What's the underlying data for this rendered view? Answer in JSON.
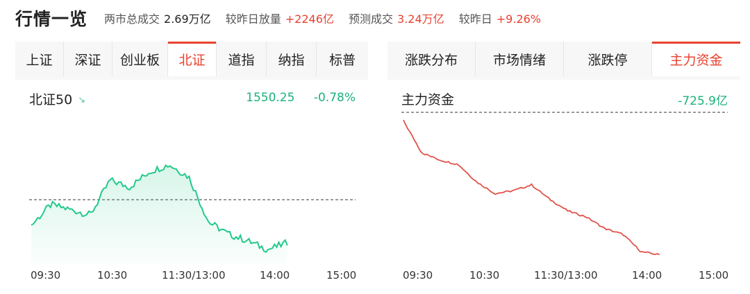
{
  "header": {
    "title": "行情一览",
    "stats": [
      {
        "label": "两市总成交",
        "value": "2.69万亿",
        "tone": "neutral"
      },
      {
        "label": "较昨日放量",
        "value": "+2246亿",
        "tone": "up"
      },
      {
        "label": "预测成交",
        "value": "3.24万亿",
        "tone": "up"
      },
      {
        "label": "较昨日",
        "value": "+9.26%",
        "tone": "up"
      }
    ]
  },
  "left_panel": {
    "tabs": [
      "上证",
      "深证",
      "创业板",
      "北证",
      "道指",
      "纳指",
      "标普"
    ],
    "active_tab": "北证",
    "index_name": "北证50",
    "trend_icon": "down-right-arrow-icon",
    "price": "1550.25",
    "change_pct": "-0.78%",
    "x_labels": [
      "09:30",
      "10:30",
      "11:30/13:00",
      "14:00",
      "15:00"
    ]
  },
  "right_panel": {
    "tabs": [
      "涨跌分布",
      "市场情绪",
      "涨跌停",
      "主力资金"
    ],
    "active_tab": "主力资金",
    "series_name": "主力资金",
    "value": "-725.9亿",
    "x_labels": [
      "09:30",
      "10:30",
      "11:30/13:00",
      "14:00",
      "15:00"
    ]
  },
  "colors": {
    "up": "#e8412f",
    "down": "#1ab27a",
    "line_green": "#22c98a",
    "line_red": "#e0524a",
    "active_tab": "#e8412f"
  },
  "chart_data": [
    {
      "type": "area",
      "x": [
        "09:30",
        "09:45",
        "10:00",
        "10:15",
        "10:30",
        "10:45",
        "11:00",
        "11:15",
        "11:30/13:00",
        "13:15",
        "13:30",
        "13:45",
        "14:00",
        "14:05"
      ],
      "series": [
        {
          "name": "北证50",
          "values": [
            1550,
            1562,
            1559,
            1556,
            1576,
            1572,
            1581,
            1585,
            1578,
            1552,
            1545,
            1541,
            1536,
            1540
          ]
        }
      ],
      "baseline": 1562.4,
      "ylim": [
        1530,
        1590
      ],
      "xlabel": "",
      "ylabel": ""
    },
    {
      "type": "line",
      "x": [
        "09:30",
        "09:35",
        "09:45",
        "10:00",
        "10:15",
        "10:30",
        "10:45",
        "11:00",
        "11:15",
        "11:30/13:00",
        "13:15",
        "13:30",
        "13:45",
        "14:00",
        "14:05"
      ],
      "series": [
        {
          "name": "主力资金",
          "values": [
            -10,
            -120,
            -145,
            -160,
            -220,
            -260,
            -250,
            -230,
            -280,
            -320,
            -340,
            -380,
            -400,
            -460,
            -470
          ]
        }
      ],
      "ylim": [
        -500,
        0
      ],
      "xlabel": "",
      "ylabel": ""
    }
  ]
}
